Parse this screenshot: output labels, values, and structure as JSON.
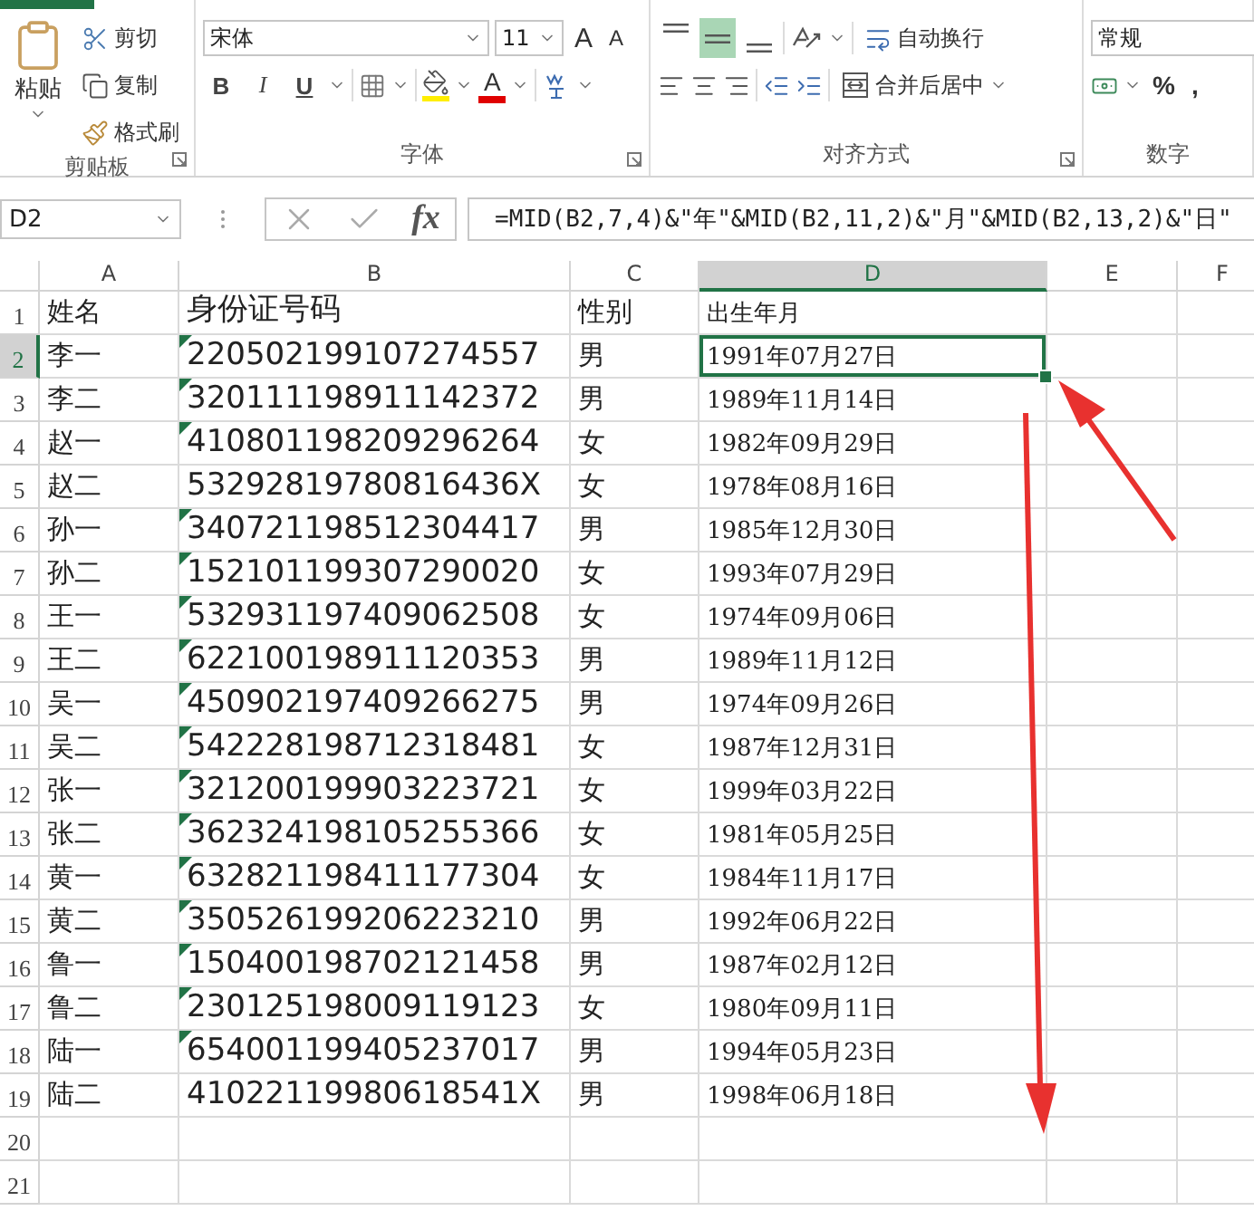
{
  "ribbon": {
    "clipboard": {
      "label": "剪贴板",
      "paste": "粘贴",
      "items": [
        "剪切",
        "复制",
        "格式刷"
      ]
    },
    "font": {
      "label": "字体",
      "font_name": "宋体",
      "font_size": "11",
      "grow": "A",
      "shrink": "A",
      "styles": [
        "B",
        "I",
        "U"
      ],
      "font_color": "A"
    },
    "alignment": {
      "label": "对齐方式",
      "vertical": [
        {
          "kind": "top",
          "selected": false
        },
        {
          "kind": "middle",
          "selected": true
        },
        {
          "kind": "bottom",
          "selected": false
        }
      ],
      "wrap": "自动换行",
      "merge": "合并后居中"
    },
    "number": {
      "label": "数字",
      "format": "常规",
      "percent": "%",
      "comma": ","
    }
  },
  "formula_bar": {
    "name_box": "D2",
    "fx": "fx",
    "formula": "=MID(B2,7,4)&\"年\"&MID(B2,11,2)&\"月\"&MID(B2,13,2)&\"日\""
  },
  "columns": [
    {
      "label": "A",
      "selected": false
    },
    {
      "label": "B",
      "selected": false
    },
    {
      "label": "C",
      "selected": false
    },
    {
      "label": "D",
      "selected": true
    },
    {
      "label": "E",
      "selected": false
    },
    {
      "label": "F",
      "selected": false
    }
  ],
  "rows": [
    {
      "number": "1",
      "selected": false,
      "text_flag": false,
      "cells": [
        "姓名",
        "身份证号码",
        "性别",
        "出生年月"
      ]
    },
    {
      "number": "2",
      "selected": true,
      "text_flag": true,
      "cells": [
        "李一",
        "220502199107274557",
        "男",
        "1991年07月27日"
      ]
    },
    {
      "number": "3",
      "selected": false,
      "text_flag": true,
      "cells": [
        "李二",
        "320111198911142372",
        "男",
        "1989年11月14日"
      ]
    },
    {
      "number": "4",
      "selected": false,
      "text_flag": true,
      "cells": [
        "赵一",
        "410801198209296264",
        "女",
        "1982年09月29日"
      ]
    },
    {
      "number": "5",
      "selected": false,
      "text_flag": false,
      "cells": [
        "赵二",
        "53292819780816436X",
        "女",
        "1978年08月16日"
      ]
    },
    {
      "number": "6",
      "selected": false,
      "text_flag": true,
      "cells": [
        "孙一",
        "340721198512304417",
        "男",
        "1985年12月30日"
      ]
    },
    {
      "number": "7",
      "selected": false,
      "text_flag": true,
      "cells": [
        "孙二",
        "152101199307290020",
        "女",
        "1993年07月29日"
      ]
    },
    {
      "number": "8",
      "selected": false,
      "text_flag": true,
      "cells": [
        "王一",
        "532931197409062508",
        "女",
        "1974年09月06日"
      ]
    },
    {
      "number": "9",
      "selected": false,
      "text_flag": true,
      "cells": [
        "王二",
        "622100198911120353",
        "男",
        "1989年11月12日"
      ]
    },
    {
      "number": "10",
      "selected": false,
      "text_flag": true,
      "cells": [
        "吴一",
        "450902197409266275",
        "男",
        "1974年09月26日"
      ]
    },
    {
      "number": "11",
      "selected": false,
      "text_flag": true,
      "cells": [
        "吴二",
        "542228198712318481",
        "女",
        "1987年12月31日"
      ]
    },
    {
      "number": "12",
      "selected": false,
      "text_flag": true,
      "cells": [
        "张一",
        "321200199903223721",
        "女",
        "1999年03月22日"
      ]
    },
    {
      "number": "13",
      "selected": false,
      "text_flag": true,
      "cells": [
        "张二",
        "362324198105255366",
        "女",
        "1981年05月25日"
      ]
    },
    {
      "number": "14",
      "selected": false,
      "text_flag": true,
      "cells": [
        "黄一",
        "632821198411177304",
        "女",
        "1984年11月17日"
      ]
    },
    {
      "number": "15",
      "selected": false,
      "text_flag": true,
      "cells": [
        "黄二",
        "350526199206223210",
        "男",
        "1992年06月22日"
      ]
    },
    {
      "number": "16",
      "selected": false,
      "text_flag": true,
      "cells": [
        "鲁一",
        "150400198702121458",
        "男",
        "1987年02月12日"
      ]
    },
    {
      "number": "17",
      "selected": false,
      "text_flag": true,
      "cells": [
        "鲁二",
        "230125198009119123",
        "女",
        "1980年09月11日"
      ]
    },
    {
      "number": "18",
      "selected": false,
      "text_flag": true,
      "cells": [
        "陆一",
        "654001199405237017",
        "男",
        "1994年05月23日"
      ]
    },
    {
      "number": "19",
      "selected": false,
      "text_flag": false,
      "cells": [
        "陆二",
        "41022119980618541X",
        "男",
        "1998年06月18日"
      ]
    },
    {
      "number": "20",
      "selected": false,
      "cells": []
    },
    {
      "number": "21",
      "selected": false,
      "cells": []
    }
  ]
}
